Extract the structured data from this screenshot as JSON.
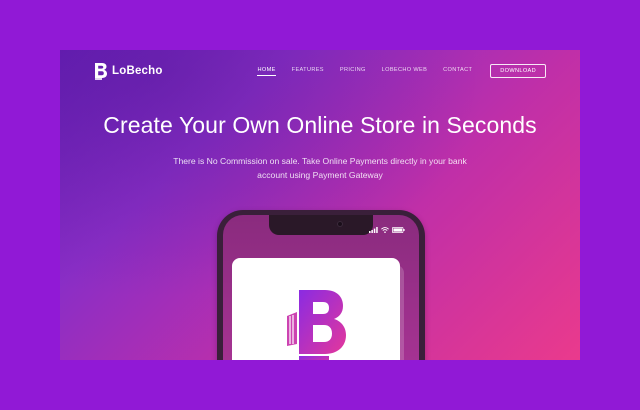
{
  "brand": {
    "name": "LoBecho",
    "primary_color": "#9119d6",
    "accent_color": "#8a2be2"
  },
  "nav": {
    "items": [
      {
        "label": "HOME",
        "active": true
      },
      {
        "label": "FEATURES",
        "active": false
      },
      {
        "label": "PRICING",
        "active": false
      },
      {
        "label": "LOBECHO WEB",
        "active": false
      },
      {
        "label": "CONTACT",
        "active": false
      }
    ],
    "download_label": "DOWNLOAD"
  },
  "hero": {
    "headline": "Create Your Own Online Store in Seconds",
    "sub_line1": "There is No Commission on sale. Take Online Payments directly in your bank",
    "sub_line2": "account using Payment Gateway"
  },
  "phone": {
    "icons": [
      "signal-icon",
      "wifi-icon",
      "battery-icon"
    ],
    "app_logo": "lobecho-b-logo"
  }
}
